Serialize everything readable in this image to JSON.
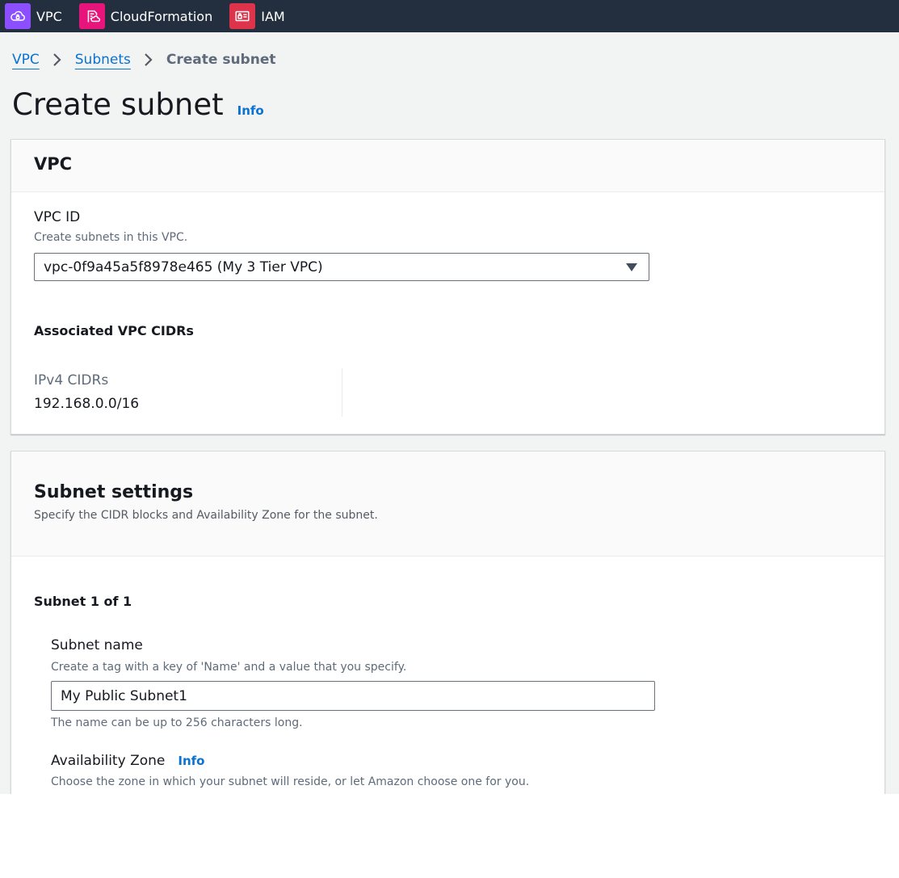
{
  "colors": {
    "topbar_bg": "#232f3e",
    "vpc_icon_bg": "#8c4fff",
    "cloudformation_icon_bg": "#e7157b",
    "iam_icon_bg": "#dd344c",
    "link": "#0972d3"
  },
  "topbar": {
    "services": [
      {
        "label": "VPC",
        "icon": "vpc-cloud-icon"
      },
      {
        "label": "CloudFormation",
        "icon": "cloudformation-icon"
      },
      {
        "label": "IAM",
        "icon": "iam-icon"
      }
    ]
  },
  "breadcrumb": {
    "items": [
      "VPC",
      "Subnets"
    ],
    "current": "Create subnet"
  },
  "page": {
    "title": "Create subnet",
    "info": "Info"
  },
  "vpc_panel": {
    "title": "VPC",
    "vpc_id_label": "VPC ID",
    "vpc_id_description": "Create subnets in this VPC.",
    "vpc_id_value": "vpc-0f9a45a5f8978e465 (My 3 Tier VPC)",
    "cidrs_heading": "Associated VPC CIDRs",
    "ipv4_label": "IPv4 CIDRs",
    "ipv4_value": "192.168.0.0/16"
  },
  "subnet_panel": {
    "title": "Subnet settings",
    "description": "Specify the CIDR blocks and Availability Zone for the subnet.",
    "subnet_count": "Subnet 1 of 1",
    "name_label": "Subnet name",
    "name_description": "Create a tag with a key of 'Name' and a value that you specify.",
    "name_value": "My Public Subnet1",
    "name_constraint": "The name can be up to 256 characters long.",
    "az_label": "Availability Zone",
    "az_info": "Info",
    "az_description": "Choose the zone in which your subnet will reside, or let Amazon choose one for you."
  }
}
